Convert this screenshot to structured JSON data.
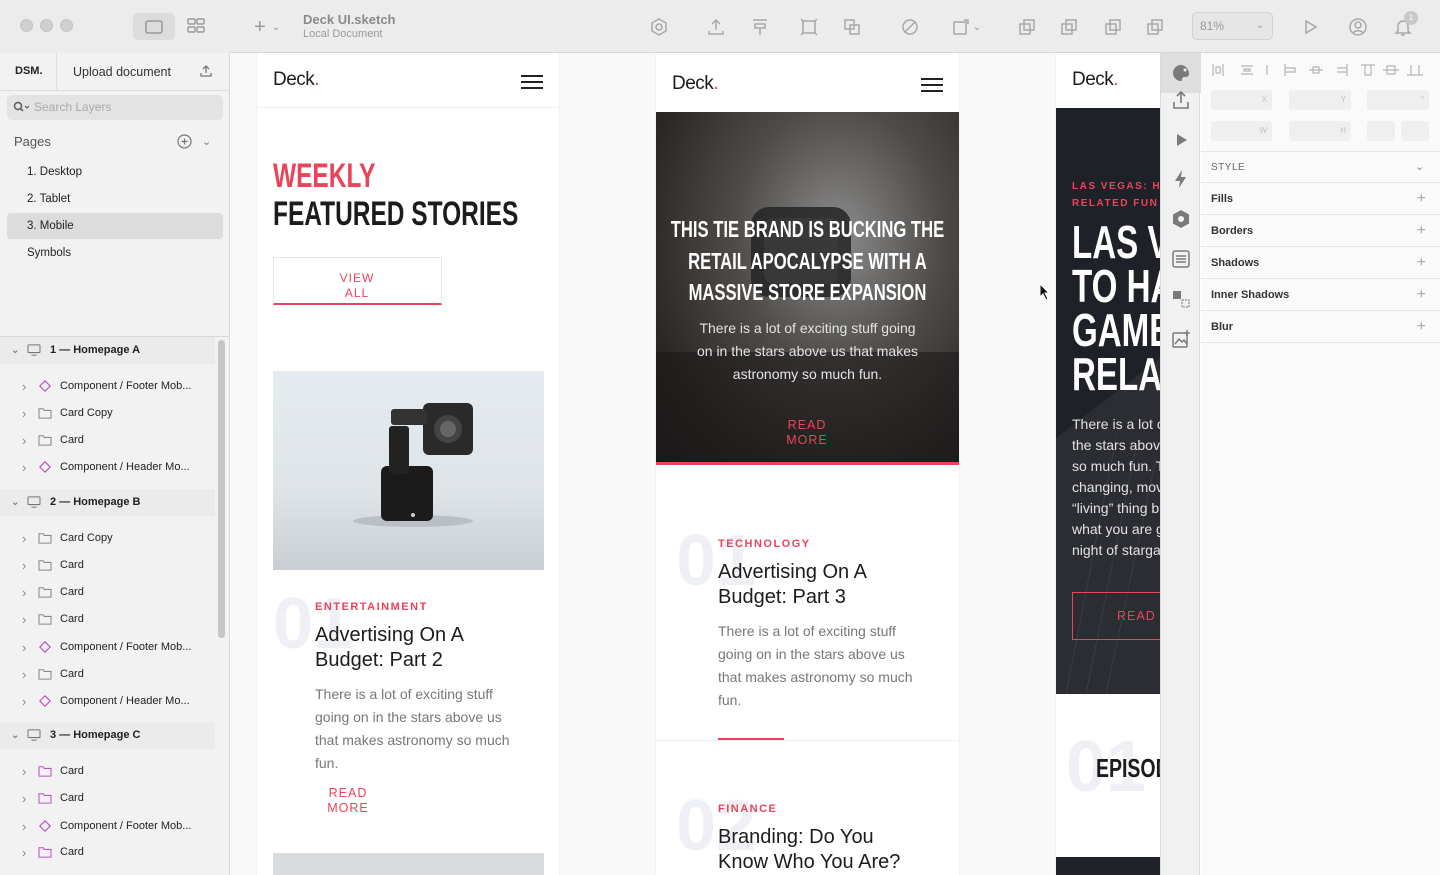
{
  "window": {
    "doc_title": "Deck UI.sketch",
    "doc_subtitle": "Local Document",
    "zoom": "81%",
    "notification_count": "1"
  },
  "sidebar": {
    "tabs": [
      "DSM.",
      "Upload document"
    ],
    "search_placeholder": "Search Layers",
    "pages_label": "Pages",
    "pages": [
      {
        "label": "1. Desktop",
        "selected": false
      },
      {
        "label": "2. Tablet",
        "selected": false
      },
      {
        "label": "3. Mobile",
        "selected": true
      },
      {
        "label": "Symbols",
        "selected": false
      }
    ],
    "layers": [
      {
        "label": "1 — Homepage A",
        "type": "artboard"
      },
      {
        "label": "Component / Footer Mob...",
        "type": "symbol"
      },
      {
        "label": "Card Copy",
        "type": "folder"
      },
      {
        "label": "Card",
        "type": "folder"
      },
      {
        "label": "Component / Header Mo...",
        "type": "symbol"
      },
      {
        "label": "2 — Homepage B",
        "type": "artboard"
      },
      {
        "label": "Card Copy",
        "type": "folder"
      },
      {
        "label": "Card",
        "type": "folder"
      },
      {
        "label": "Card",
        "type": "folder"
      },
      {
        "label": "Card",
        "type": "folder"
      },
      {
        "label": "Component / Footer Mob...",
        "type": "symbol"
      },
      {
        "label": "Card",
        "type": "folder"
      },
      {
        "label": "Component / Header Mo...",
        "type": "symbol"
      },
      {
        "label": "3 — Homepage C",
        "type": "artboard"
      },
      {
        "label": "Card",
        "type": "folder-pink"
      },
      {
        "label": "Card",
        "type": "folder-pink"
      },
      {
        "label": "Component / Footer Mob...",
        "type": "symbol"
      },
      {
        "label": "Card",
        "type": "folder-pink"
      }
    ]
  },
  "canvas": {
    "logo": "Deck",
    "logo_dot": ".",
    "a": {
      "headline_1": "WEEKLY",
      "headline_2": "FEATURED STORIES",
      "view_all": "VIEW ALL",
      "card_num": "01",
      "kicker": "ENTERTAINMENT",
      "title": "Advertising On A Budget: Part 2",
      "body": "There is a lot of exciting stuff going on in the stars above us that makes astronomy so much fun.",
      "read_more": "READ MORE"
    },
    "b": {
      "hero_title": "THIS TIE BRAND IS BUCKING THE RETAIL APOCALYPSE WITH A MASSIVE STORE EXPANSION",
      "hero_body": "There is a lot of exciting stuff going on in the stars above us that makes astronomy so much fun.",
      "hero_read_more": "READ MORE",
      "card1_num": "01",
      "card1_kicker": "TECHNOLOGY",
      "card1_title": "Advertising On A Budget: Part 3",
      "card1_body": "There is a lot of exciting stuff going on in the stars above us that makes astronomy so much fun.",
      "card2_num": "02",
      "card2_kicker": "FINANCE",
      "card2_title": "Branding: Do You Know Who You Are?"
    },
    "c": {
      "kicker_1": "LAS VEGAS: HOW",
      "kicker_2": "RELATED FUN",
      "hero_lines": [
        "LAS VE",
        "TO HA",
        "GAMB",
        "RELAT"
      ],
      "body_lines": [
        "There is a lot o",
        "the stars abov",
        "so much fun. T",
        "changing, mov",
        "“living” thing b",
        "what you are g",
        "night of starga"
      ],
      "read_more": "READ M",
      "num": "01",
      "episode": "EPISOD"
    }
  },
  "inspector": {
    "field_labels": [
      "X",
      "Y",
      "°",
      "W",
      "H"
    ],
    "style_label": "STYLE",
    "sections": [
      "Fills",
      "Borders",
      "Shadows",
      "Inner Shadows",
      "Blur"
    ]
  },
  "colors": {
    "accent": "#e9445a",
    "sidebar_bg": "#f2f2f2",
    "canvas_bg": "#f9f9f9",
    "dark_card": "#1f2128"
  }
}
